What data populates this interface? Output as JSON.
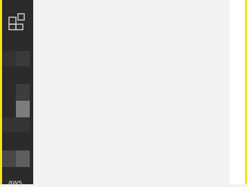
{
  "sidebar": {
    "apps_icon": "apps-grid-icon",
    "footer_label": "aws"
  },
  "colors": {
    "frame_accent": "#f5e61a",
    "sidebar_bg": "#2b2b2b",
    "main_bg": "#f2f2f2",
    "right_strip_bg": "#ffffff"
  }
}
